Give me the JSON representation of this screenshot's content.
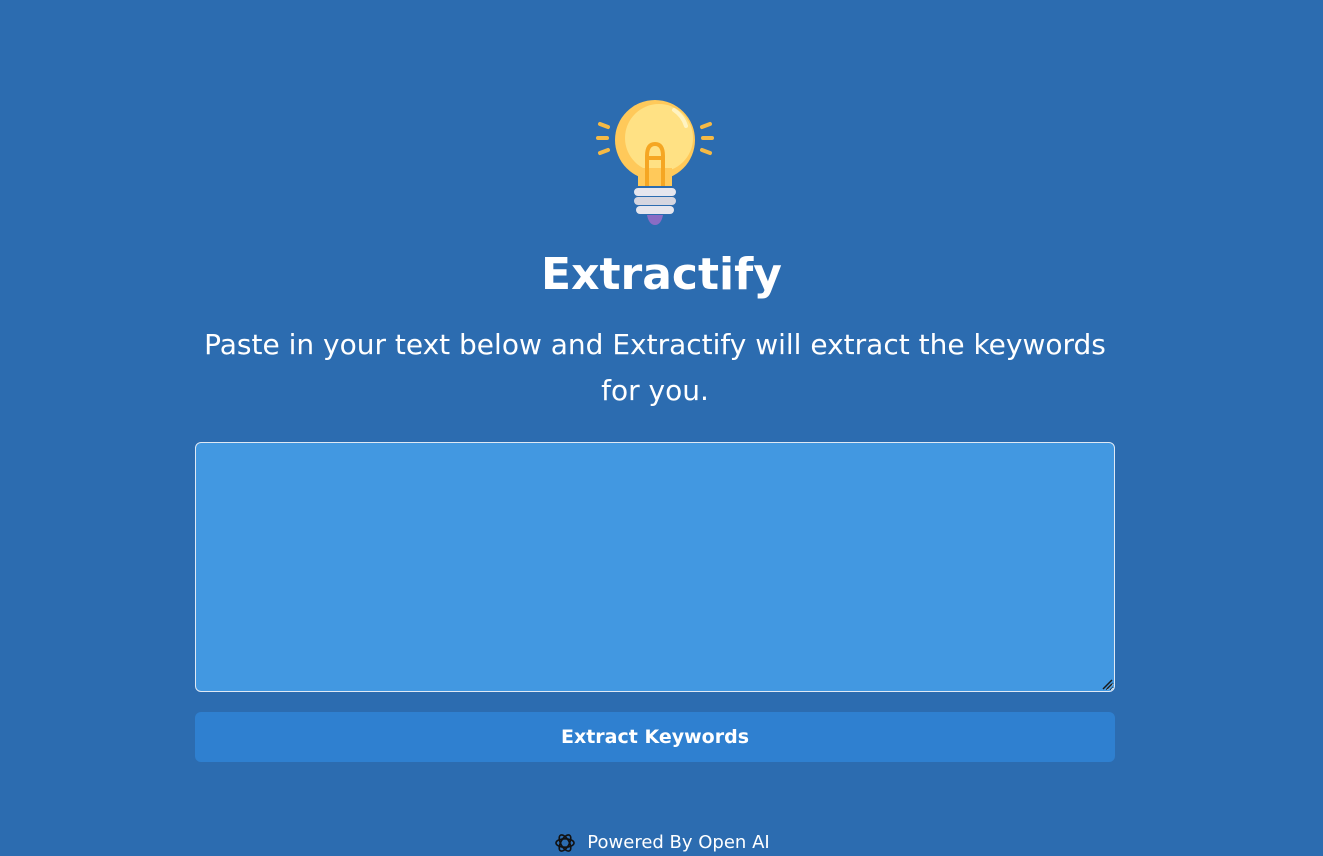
{
  "app": {
    "logo_icon": "lightbulb-icon",
    "title": "Extractify",
    "subtitle": "Paste in your text below and Extractify will extract the keywords for you."
  },
  "input": {
    "value": "",
    "placeholder": ""
  },
  "actions": {
    "extract_label": "Extract Keywords"
  },
  "footer": {
    "icon": "openai-icon",
    "text": "Powered By Open AI"
  },
  "colors": {
    "background": "#2c6cb0",
    "textarea_bg": "#4298e1",
    "button_bg": "#2f80d0",
    "text": "#ffffff"
  }
}
